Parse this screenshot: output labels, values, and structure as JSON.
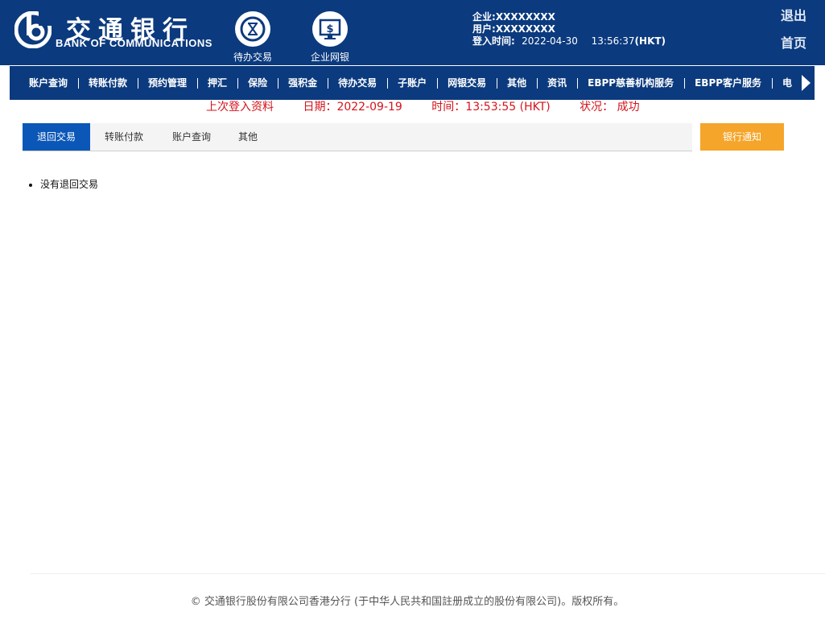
{
  "header": {
    "logo_cn": "交通银行",
    "logo_en": "BANK OF COMMUNICATIONS",
    "pending_label": "待办交易",
    "corp_label": "企业网银",
    "company_label": "企业:",
    "company_value": "XXXXXXXX",
    "user_label": "用户:",
    "user_value": "XXXXXXXX",
    "login_time_label": "登入时间:",
    "login_date": "2022-04-30",
    "login_time": "13:56:37",
    "login_tz": "(HKT)",
    "logout": "退出",
    "home": "首页"
  },
  "nav": {
    "items": [
      {
        "label": "账户查询"
      },
      {
        "label": "转账付款"
      },
      {
        "label": "预约管理"
      },
      {
        "label": "押汇"
      },
      {
        "label": "保险"
      },
      {
        "label": "强积金"
      },
      {
        "label": "待办交易"
      },
      {
        "label": "子账户"
      },
      {
        "label": "网银交易"
      },
      {
        "label": "其他"
      },
      {
        "label": "资讯"
      },
      {
        "label": "EBPP慈善机构服务"
      },
      {
        "label": "EBPP客户服务"
      },
      {
        "label": "电"
      }
    ]
  },
  "last_login": {
    "title": "上次登入资料",
    "date": "日期：2022-09-19",
    "time": "时间：13:53:55 (HKT)",
    "status": "状况： 成功"
  },
  "tabs": [
    {
      "label": "退回交易",
      "active": true
    },
    {
      "label": "转账付款"
    },
    {
      "label": "账户查询"
    },
    {
      "label": "其他"
    }
  ],
  "notice_button": "银行通知",
  "content": {
    "items": [
      "没有退回交易"
    ]
  },
  "footer": "© 交通银行股份有限公司香港分行 (于中华人民共和国註册成立的股份有限公司)。版权所有。",
  "colors": {
    "brand": "#0b3a7e",
    "tab_active": "#0b57b8",
    "notice": "#f5a52a",
    "alert": "#d4141b"
  }
}
